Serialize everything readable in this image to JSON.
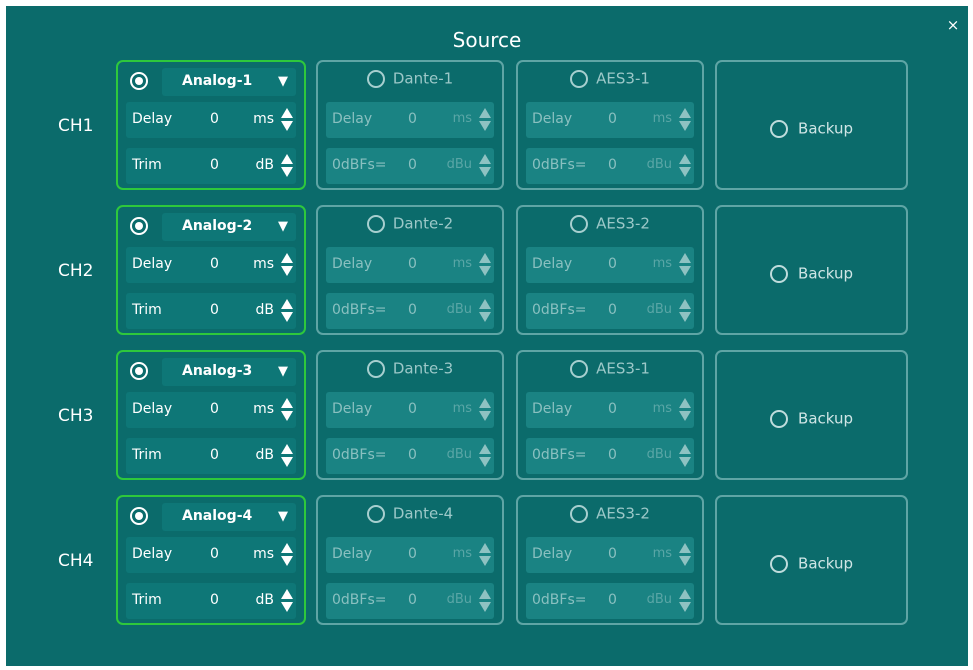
{
  "dialog": {
    "title": "Source",
    "close_label": "×"
  },
  "channels": [
    {
      "label": "CH1",
      "analog": {
        "name": "Analog-1",
        "arrow": "▼",
        "delay_label": "Delay",
        "delay_value": "0",
        "delay_unit": "ms",
        "trim_label": "Trim",
        "trim_value": "0",
        "trim_unit": "dB"
      },
      "dante": {
        "name": "Dante-1",
        "delay_label": "Delay",
        "delay_value": "0",
        "delay_unit": "ms",
        "level_label": "0dBFs=",
        "level_value": "0",
        "level_unit": "dBu"
      },
      "aes": {
        "name": "AES3-1",
        "delay_label": "Delay",
        "delay_value": "0",
        "delay_unit": "ms",
        "level_label": "0dBFs=",
        "level_value": "0",
        "level_unit": "dBu"
      },
      "backup_label": "Backup"
    },
    {
      "label": "CH2",
      "analog": {
        "name": "Analog-2",
        "arrow": "▼",
        "delay_label": "Delay",
        "delay_value": "0",
        "delay_unit": "ms",
        "trim_label": "Trim",
        "trim_value": "0",
        "trim_unit": "dB"
      },
      "dante": {
        "name": "Dante-2",
        "delay_label": "Delay",
        "delay_value": "0",
        "delay_unit": "ms",
        "level_label": "0dBFs=",
        "level_value": "0",
        "level_unit": "dBu"
      },
      "aes": {
        "name": "AES3-2",
        "delay_label": "Delay",
        "delay_value": "0",
        "delay_unit": "ms",
        "level_label": "0dBFs=",
        "level_value": "0",
        "level_unit": "dBu"
      },
      "backup_label": "Backup"
    },
    {
      "label": "CH3",
      "analog": {
        "name": "Analog-3",
        "arrow": "▼",
        "delay_label": "Delay",
        "delay_value": "0",
        "delay_unit": "ms",
        "trim_label": "Trim",
        "trim_value": "0",
        "trim_unit": "dB"
      },
      "dante": {
        "name": "Dante-3",
        "delay_label": "Delay",
        "delay_value": "0",
        "delay_unit": "ms",
        "level_label": "0dBFs=",
        "level_value": "0",
        "level_unit": "dBu"
      },
      "aes": {
        "name": "AES3-1",
        "delay_label": "Delay",
        "delay_value": "0",
        "delay_unit": "ms",
        "level_label": "0dBFs=",
        "level_value": "0",
        "level_unit": "dBu"
      },
      "backup_label": "Backup"
    },
    {
      "label": "CH4",
      "analog": {
        "name": "Analog-4",
        "arrow": "▼",
        "delay_label": "Delay",
        "delay_value": "0",
        "delay_unit": "ms",
        "trim_label": "Trim",
        "trim_value": "0",
        "trim_unit": "dB"
      },
      "dante": {
        "name": "Dante-4",
        "delay_label": "Delay",
        "delay_value": "0",
        "delay_unit": "ms",
        "level_label": "0dBFs=",
        "level_value": "0",
        "level_unit": "dBu"
      },
      "aes": {
        "name": "AES3-2",
        "delay_label": "Delay",
        "delay_value": "0",
        "delay_unit": "ms",
        "level_label": "0dBFs=",
        "level_value": "0",
        "level_unit": "dBu"
      },
      "backup_label": "Backup"
    }
  ],
  "colors": {
    "background": "#0b6b6b",
    "field": "#0e7777",
    "selected_border": "#2ec83c",
    "card_border": "#5fa5a5",
    "text": "#ffffff",
    "disabled_text": "#8ac0c0"
  },
  "icons": {
    "close": "close-icon",
    "dropdown": "chevron-down-icon",
    "spinner": "spinner-arrows-icon",
    "radio": "radio-button-icon"
  }
}
